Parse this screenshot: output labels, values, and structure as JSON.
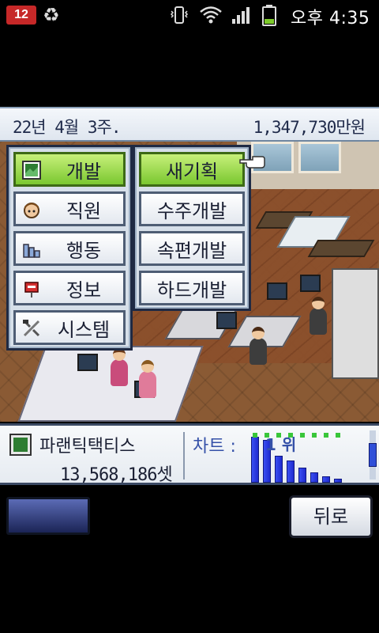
{
  "status_bar": {
    "notification_badge": "12",
    "time": "오후 4:35",
    "icons": [
      "recycle-icon",
      "vibrate-icon",
      "wifi-icon",
      "signal-icon",
      "battery-icon"
    ]
  },
  "header": {
    "date": "22년 4월 3주.",
    "money": "1,347,730만원"
  },
  "main_menu": {
    "items": [
      {
        "label": "개발",
        "icon": "development-icon",
        "active": true
      },
      {
        "label": "직원",
        "icon": "staff-icon",
        "active": false
      },
      {
        "label": "행동",
        "icon": "action-icon",
        "active": false
      },
      {
        "label": "정보",
        "icon": "info-mailbox-icon",
        "active": false
      },
      {
        "label": "시스템",
        "icon": "system-tools-icon",
        "active": false
      }
    ]
  },
  "sub_menu": {
    "items": [
      {
        "label": "새기획",
        "active": true
      },
      {
        "label": "수주개발",
        "active": false
      },
      {
        "label": "속편개발",
        "active": false
      },
      {
        "label": "하드개발",
        "active": false
      }
    ]
  },
  "info_panel": {
    "product_name": "파랜틱택티스",
    "sales": "13,568,186셋",
    "chart_label": "차트 :",
    "rank": "1 위"
  },
  "chart_data": {
    "type": "bar",
    "values": [
      62,
      58,
      36,
      30,
      20,
      14,
      9,
      5
    ]
  },
  "controls": {
    "back_label": "뒤로"
  },
  "colors": {
    "menu_active": "#7ac730",
    "menu_border": "#1f2a44",
    "chart_bar": "#2f3fe0",
    "notification": "#c62828"
  }
}
